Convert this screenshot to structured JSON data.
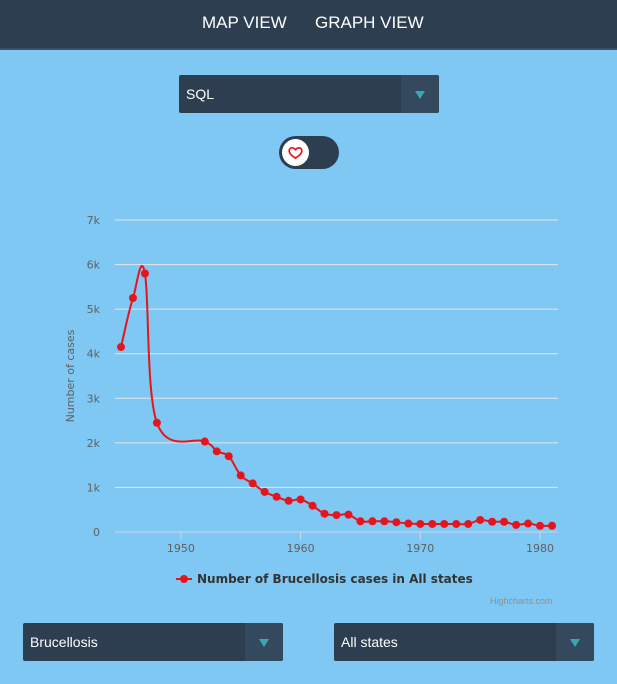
{
  "nav": {
    "items": [
      "MAP VIEW",
      "GRAPH VIEW"
    ]
  },
  "query_select": {
    "value": "SQL"
  },
  "favorite_toggle": {
    "icon": "heart-icon",
    "state": "off"
  },
  "disease_select": {
    "value": "Brucellosis"
  },
  "state_select": {
    "value": "All states"
  },
  "credit": "Highcharts.com",
  "colors": {
    "background": "#7ec8f3",
    "bar": "#2c3e50",
    "series": "#e8141c",
    "accent": "#3aa6b0"
  },
  "chart_data": {
    "type": "line",
    "title": "",
    "xlabel": "",
    "ylabel": "Number of cases",
    "xlim": [
      1944.5,
      1981.5
    ],
    "ylim": [
      0,
      7000
    ],
    "x_ticks": [
      1950,
      1960,
      1970,
      1980
    ],
    "y_ticks": [
      "0",
      "1k",
      "2k",
      "3k",
      "4k",
      "5k",
      "6k",
      "7k"
    ],
    "y_tick_values": [
      0,
      1000,
      2000,
      3000,
      4000,
      5000,
      6000,
      7000
    ],
    "grid": true,
    "legend_position": "bottom",
    "series": [
      {
        "name": "Number of Brucellosis cases in All states",
        "x": [
          1945,
          1946,
          1947,
          1948,
          1952,
          1953,
          1954,
          1955,
          1956,
          1957,
          1958,
          1959,
          1960,
          1961,
          1962,
          1963,
          1964,
          1965,
          1966,
          1967,
          1968,
          1969,
          1970,
          1971,
          1972,
          1973,
          1974,
          1975,
          1976,
          1977,
          1978,
          1979,
          1980,
          1981
        ],
        "y": [
          4150,
          5250,
          5800,
          2450,
          2030,
          1810,
          1700,
          1270,
          1090,
          900,
          790,
          700,
          730,
          590,
          410,
          380,
          390,
          240,
          240,
          240,
          220,
          190,
          180,
          180,
          180,
          180,
          180,
          270,
          230,
          230,
          160,
          190,
          140,
          140
        ]
      }
    ]
  }
}
